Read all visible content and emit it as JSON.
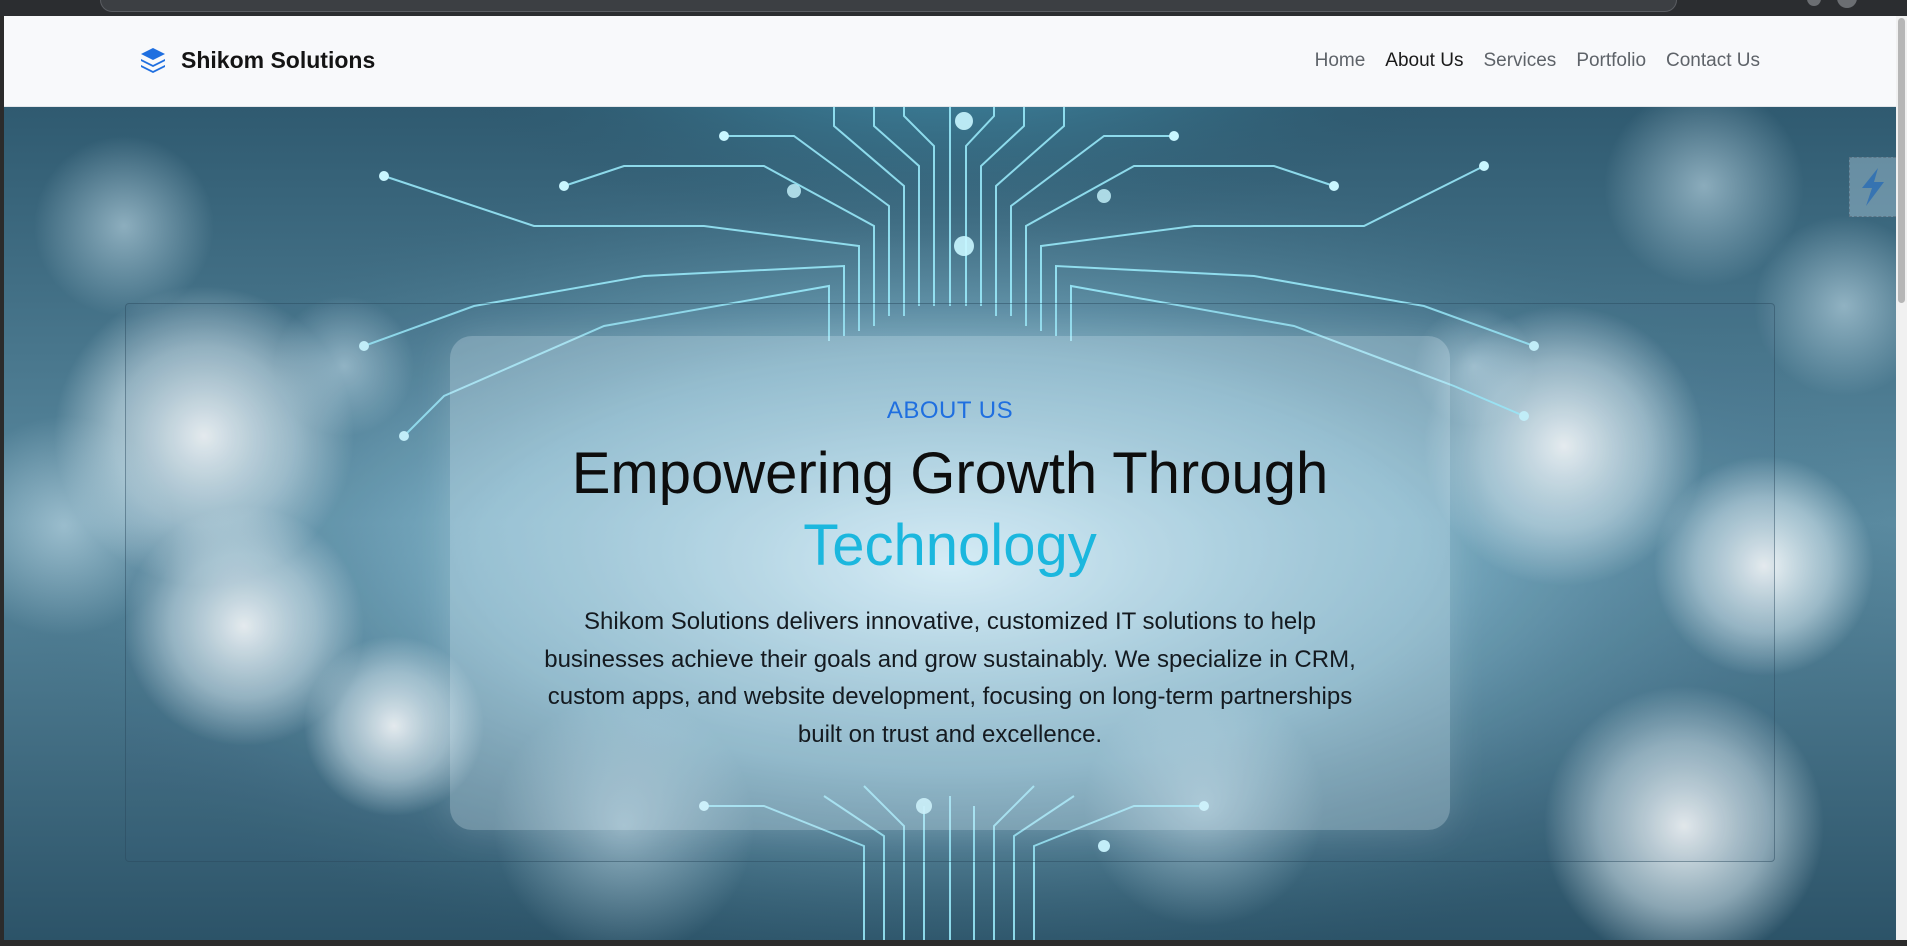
{
  "navbar": {
    "brand": "Shikom Solutions",
    "brand_icon": "layers-icon",
    "links": [
      "Home",
      "About Us",
      "Services",
      "Portfolio",
      "Contact Us"
    ],
    "active_link": "About Us"
  },
  "hero": {
    "eyebrow": "ABOUT US",
    "heading_line1": "Empowering Growth Through",
    "heading_line2": "Technology",
    "description": "Shikom Solutions delivers innovative, customized IT solutions to help businesses achieve their goals and grow sustainably. We specialize in CRM, custom apps, and website development, focusing on long-term partnerships built on trust and excellence.",
    "background": "circuit-board-bokeh-image"
  },
  "side_widget": {
    "icon": "lightning-icon"
  },
  "colors": {
    "brand_blue": "#1f6fe0",
    "accent_cyan": "#1bb7de",
    "navbar_bg": "#f8f9fb",
    "hero_bg": "#345d72"
  }
}
